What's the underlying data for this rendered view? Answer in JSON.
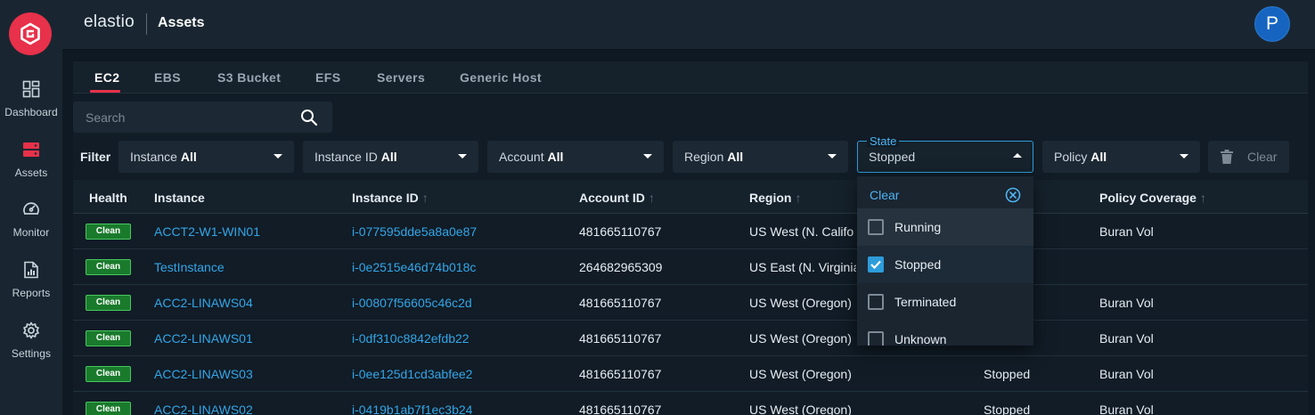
{
  "app": {
    "brand": "elastio",
    "page_title": "Assets",
    "avatar_initial": "P",
    "brand_color": "#e8314a",
    "accent": "#2d9cdb"
  },
  "sidebar": {
    "items": [
      {
        "label": "Dashboard",
        "icon": "dashboard-icon"
      },
      {
        "label": "Assets",
        "icon": "assets-icon",
        "active": true
      },
      {
        "label": "Monitor",
        "icon": "monitor-icon"
      },
      {
        "label": "Reports",
        "icon": "reports-icon"
      },
      {
        "label": "Settings",
        "icon": "gear-icon"
      }
    ]
  },
  "tabs": [
    {
      "label": "EC2",
      "active": true
    },
    {
      "label": "EBS"
    },
    {
      "label": "S3 Bucket"
    },
    {
      "label": "EFS"
    },
    {
      "label": "Servers"
    },
    {
      "label": "Generic Host"
    }
  ],
  "search": {
    "placeholder": "Search",
    "value": ""
  },
  "filters": {
    "label": "Filter",
    "instance": {
      "prefix": "Instance",
      "value": "All"
    },
    "instance_id": {
      "prefix": "Instance ID",
      "value": "All"
    },
    "account": {
      "prefix": "Account",
      "value": "All"
    },
    "region": {
      "prefix": "Region",
      "value": "All"
    },
    "state": {
      "label": "State",
      "value": "Stopped"
    },
    "policy": {
      "prefix": "Policy",
      "value": "All"
    },
    "clear_label": "Clear"
  },
  "state_menu": {
    "clear_label": "Clear",
    "options": [
      {
        "label": "Running",
        "checked": false
      },
      {
        "label": "Stopped",
        "checked": true
      },
      {
        "label": "Terminated",
        "checked": false
      },
      {
        "label": "Unknown",
        "checked": false
      }
    ]
  },
  "table": {
    "columns": {
      "health": "Health",
      "instance": "Instance",
      "instance_id": "Instance ID",
      "account_id": "Account ID",
      "region": "Region",
      "policy_coverage": "Policy Coverage"
    },
    "sort_arrow": "↑",
    "rows": [
      {
        "health": "Clean",
        "instance": "ACCT2-W1-WIN01",
        "instance_id": "i-077595dde5a8a0e87",
        "account_id": "481665110767",
        "region": "US West (N. Califo",
        "state": "",
        "policy": "Buran Vol"
      },
      {
        "health": "Clean",
        "instance": "TestInstance",
        "instance_id": "i-0e2515e46d74b018c",
        "account_id": "264682965309",
        "region": "US East (N. Virginia",
        "state": "",
        "policy": ""
      },
      {
        "health": "Clean",
        "instance": "ACC2-LINAWS04",
        "instance_id": "i-00807f56605c46c2d",
        "account_id": "481665110767",
        "region": "US West (Oregon)",
        "state": "",
        "policy": "Buran Vol"
      },
      {
        "health": "Clean",
        "instance": "ACC2-LINAWS01",
        "instance_id": "i-0df310c8842efdb22",
        "account_id": "481665110767",
        "region": "US West (Oregon)",
        "state": "",
        "policy": "Buran Vol"
      },
      {
        "health": "Clean",
        "instance": "ACC2-LINAWS03",
        "instance_id": "i-0ee125d1cd3abfee2",
        "account_id": "481665110767",
        "region": "US West (Oregon)",
        "state": "Stopped",
        "policy": "Buran Vol"
      },
      {
        "health": "Clean",
        "instance": "ACC2-LINAWS02",
        "instance_id": "i-0419b1ab7f1ec3b24",
        "account_id": "481665110767",
        "region": "US West (Oregon)",
        "state": "Stopped",
        "policy": "Buran Vol"
      }
    ]
  }
}
